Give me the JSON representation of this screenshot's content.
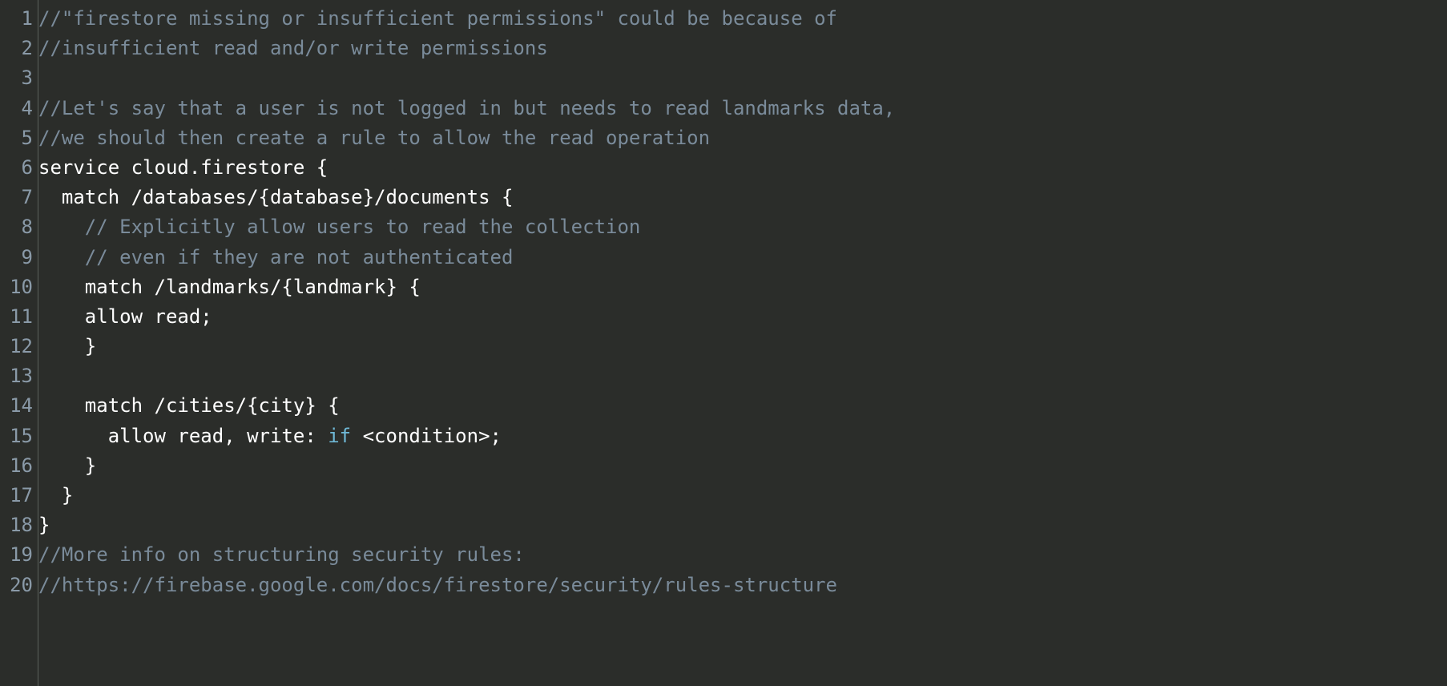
{
  "lineCount": 20,
  "lines": [
    {
      "tokens": [
        {
          "cls": "tok-comment",
          "text": "//\"firestore missing or insufficient permissions\" could be because of"
        }
      ]
    },
    {
      "tokens": [
        {
          "cls": "tok-comment",
          "text": "//insufficient read and/or write permissions"
        }
      ]
    },
    {
      "tokens": []
    },
    {
      "tokens": [
        {
          "cls": "tok-comment",
          "text": "//Let's say that a user is not logged in but needs to read landmarks data,"
        }
      ]
    },
    {
      "tokens": [
        {
          "cls": "tok-comment",
          "text": "//we should then create a rule to allow the read operation"
        }
      ]
    },
    {
      "tokens": [
        {
          "cls": "tok-plain",
          "text": "service cloud.firestore {"
        }
      ]
    },
    {
      "tokens": [
        {
          "cls": "tok-plain",
          "text": "  match /databases/{database}/documents {"
        }
      ]
    },
    {
      "tokens": [
        {
          "cls": "tok-plain",
          "text": "    "
        },
        {
          "cls": "tok-comment",
          "text": "// Explicitly allow users to read the collection"
        }
      ]
    },
    {
      "tokens": [
        {
          "cls": "tok-plain",
          "text": "    "
        },
        {
          "cls": "tok-comment",
          "text": "// even if they are not authenticated"
        }
      ]
    },
    {
      "tokens": [
        {
          "cls": "tok-plain",
          "text": "    match /landmarks/{landmark} {"
        }
      ]
    },
    {
      "tokens": [
        {
          "cls": "tok-plain",
          "text": "    allow read;"
        }
      ]
    },
    {
      "tokens": [
        {
          "cls": "tok-plain",
          "text": "    }    "
        }
      ]
    },
    {
      "tokens": []
    },
    {
      "tokens": [
        {
          "cls": "tok-plain",
          "text": "    match /cities/{city} {"
        }
      ]
    },
    {
      "tokens": [
        {
          "cls": "tok-plain",
          "text": "      allow read, write: "
        },
        {
          "cls": "tok-keyword",
          "text": "if"
        },
        {
          "cls": "tok-plain",
          "text": " <condition>;"
        }
      ]
    },
    {
      "tokens": [
        {
          "cls": "tok-plain",
          "text": "    }"
        }
      ]
    },
    {
      "tokens": [
        {
          "cls": "tok-plain",
          "text": "  }"
        }
      ]
    },
    {
      "tokens": [
        {
          "cls": "tok-plain",
          "text": "}"
        }
      ]
    },
    {
      "tokens": [
        {
          "cls": "tok-comment",
          "text": "//More info on structuring security rules:"
        }
      ]
    },
    {
      "tokens": [
        {
          "cls": "tok-comment",
          "text": "//https://firebase.google.com/docs/firestore/security/rules-structure"
        }
      ]
    }
  ]
}
